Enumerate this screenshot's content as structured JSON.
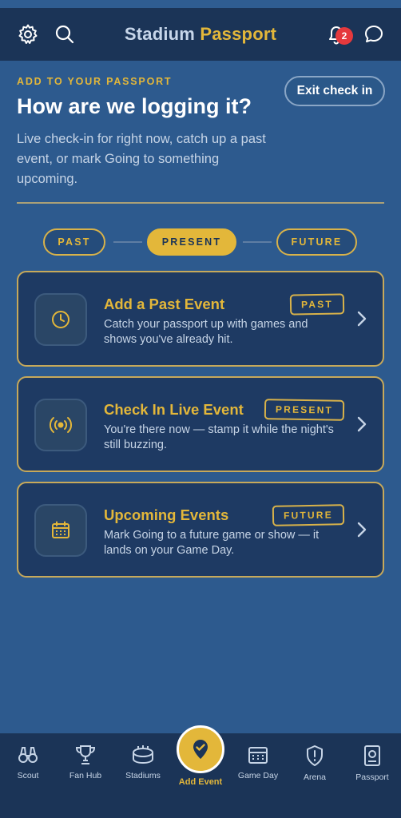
{
  "header": {
    "title_part1": "Stadium",
    "title_part2": "Passport",
    "notification_count": "2",
    "icons": [
      "gear-icon",
      "search-icon",
      "bell-icon",
      "chat-icon"
    ]
  },
  "intro": {
    "eyebrow": "ADD TO YOUR PASSPORT",
    "headline": "How are we logging it?",
    "description": "Live check-in for right now, catch up a past event, or mark Going to something upcoming.",
    "exit_button": "Exit check in"
  },
  "timeline": {
    "items": [
      "PAST",
      "PRESENT",
      "FUTURE"
    ],
    "selected": "PRESENT"
  },
  "cards": [
    {
      "title": "Add a Past Event",
      "description": "Catch your passport up with games and shows you've already hit.",
      "stamp": "PAST",
      "icon": "clock-icon"
    },
    {
      "title": "Check In Live Event",
      "description": "You're there now — stamp it while the night's still buzzing.",
      "stamp": "PRESENT",
      "icon": "broadcast-icon"
    },
    {
      "title": "Upcoming Events",
      "description": "Mark Going to a future game or show — it lands on your Game Day.",
      "stamp": "FUTURE",
      "icon": "calendar-icon"
    }
  ],
  "tabbar": {
    "tabs": [
      {
        "label": "Scout",
        "icon": "binoculars-icon"
      },
      {
        "label": "Fan Hub",
        "icon": "trophy-icon"
      },
      {
        "label": "Stadiums",
        "icon": "stadium-icon"
      },
      {
        "label": "Add Event",
        "icon": "checkmark-pin-icon"
      },
      {
        "label": "Game Day",
        "icon": "calendar-icon"
      },
      {
        "label": "Arena",
        "icon": "shield-icon"
      },
      {
        "label": "Passport",
        "icon": "passport-icon"
      }
    ],
    "active": "Add Event"
  },
  "colors": {
    "background": "#2d5a8e",
    "header": "#1b3457",
    "accent": "#e3b73a",
    "card": "#1e3a63",
    "badge": "#e5393d"
  }
}
